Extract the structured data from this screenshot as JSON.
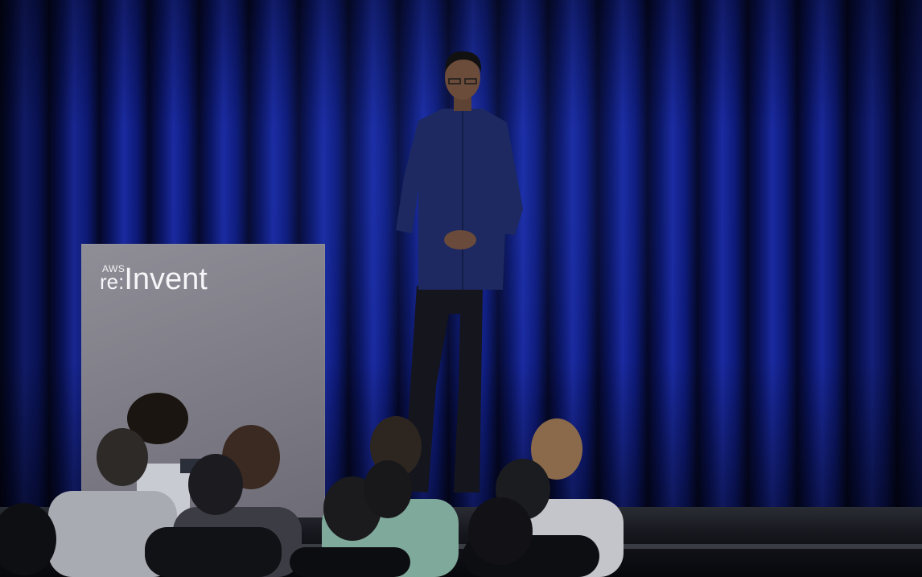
{
  "logo": {
    "small_text": "AWS",
    "prefix": "re:",
    "word": "Invent"
  },
  "colors": {
    "curtain": "#0d1a78",
    "banner": "#807e88",
    "shirt": "#1d2960",
    "stage": "#15161c"
  }
}
